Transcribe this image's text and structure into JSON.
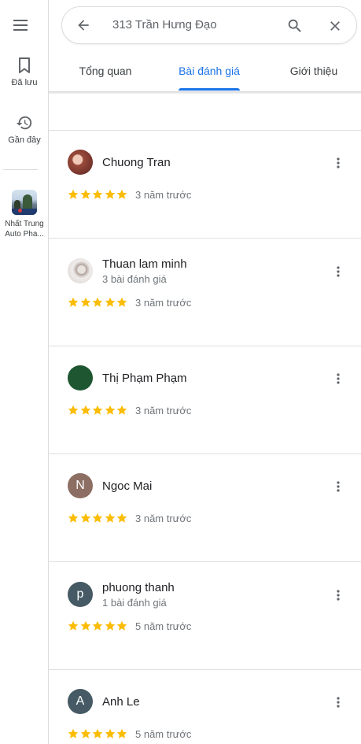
{
  "colors": {
    "accent": "#1a73e8",
    "star": "#fbbc04",
    "divider": "#e0e0e0"
  },
  "rail": {
    "menu_icon": "menu-icon",
    "saved": {
      "label": "Đã lưu",
      "icon": "bookmark-icon"
    },
    "recent": {
      "label": "Gần đây",
      "icon": "history-icon"
    },
    "recent_place": {
      "label": "Nhất Trung Auto Pha...",
      "icon": "place-thumbnail"
    }
  },
  "search": {
    "value": "313 Trần Hưng Đạo",
    "back_icon": "arrow-back-icon",
    "search_icon": "search-icon",
    "close_icon": "close-icon"
  },
  "tabs": [
    {
      "label": "Tổng quan",
      "active": false
    },
    {
      "label": "Bài đánh giá",
      "active": true
    },
    {
      "label": "Giới thiệu",
      "active": false
    }
  ],
  "reviews": [
    {
      "name": "Chuong Tran",
      "sub": "",
      "avatar": "photo",
      "initial": "",
      "rating": 5,
      "date": "3 năm trước"
    },
    {
      "name": "Thuan lam minh",
      "sub": "3 bài đánh giá",
      "avatar": "photo",
      "initial": "",
      "rating": 5,
      "date": "3 năm trước"
    },
    {
      "name": "Thị Phạm Phạm",
      "sub": "",
      "avatar": "#1e5631",
      "initial": "",
      "rating": 5,
      "date": "3 năm trước"
    },
    {
      "name": "Ngoc Mai",
      "sub": "",
      "avatar": "#8d6e63",
      "initial": "N",
      "rating": 5,
      "date": "3 năm trước"
    },
    {
      "name": "phuong thanh",
      "sub": "1 bài đánh giá",
      "avatar": "#455a64",
      "initial": "p",
      "rating": 5,
      "date": "5 năm trước"
    },
    {
      "name": "Anh Le",
      "sub": "",
      "avatar": "#455a64",
      "initial": "A",
      "rating": 5,
      "date": "5 năm trước"
    }
  ]
}
